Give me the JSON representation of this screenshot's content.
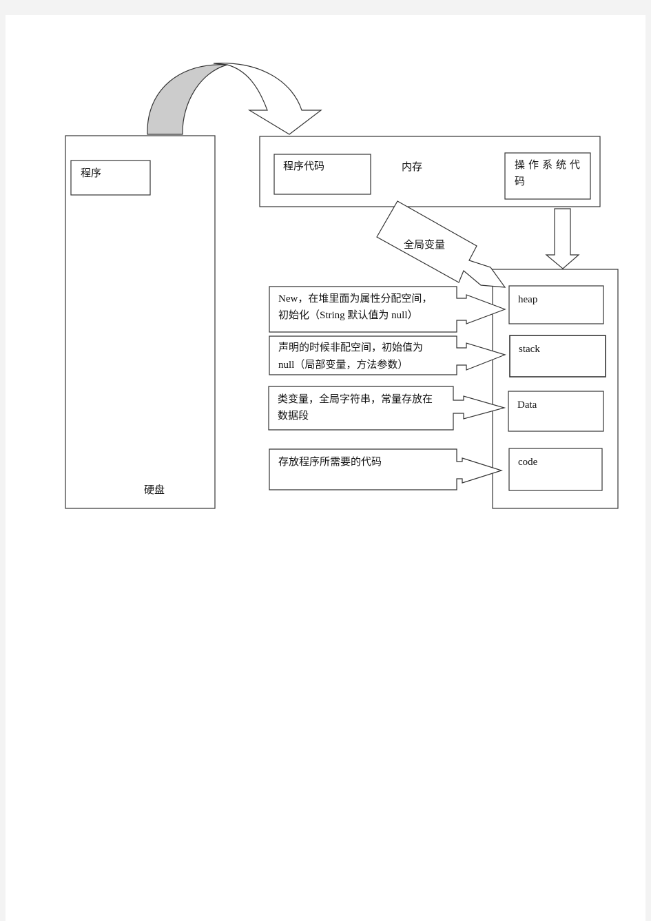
{
  "diagram": {
    "disk": {
      "label": "硬盘",
      "program": "程序"
    },
    "memory": {
      "label": "内存",
      "program_code": "程序代码",
      "os_code": "操作系统代码"
    },
    "global_arrow": "全局变量",
    "segments": [
      {
        "label": "heap",
        "note": [
          "New，在堆里面为属性分配空间，",
          "初始化（String 默认值为 null）"
        ]
      },
      {
        "label": "stack",
        "note": [
          "声明的时候非配空间，初始值为",
          "null（局部变量，方法参数）"
        ]
      },
      {
        "label": "Data",
        "note": [
          "类变量，全局字符串，常量存放在",
          "数据段"
        ]
      },
      {
        "label": "code",
        "note": [
          "存放程序所需要的代码"
        ]
      }
    ]
  }
}
